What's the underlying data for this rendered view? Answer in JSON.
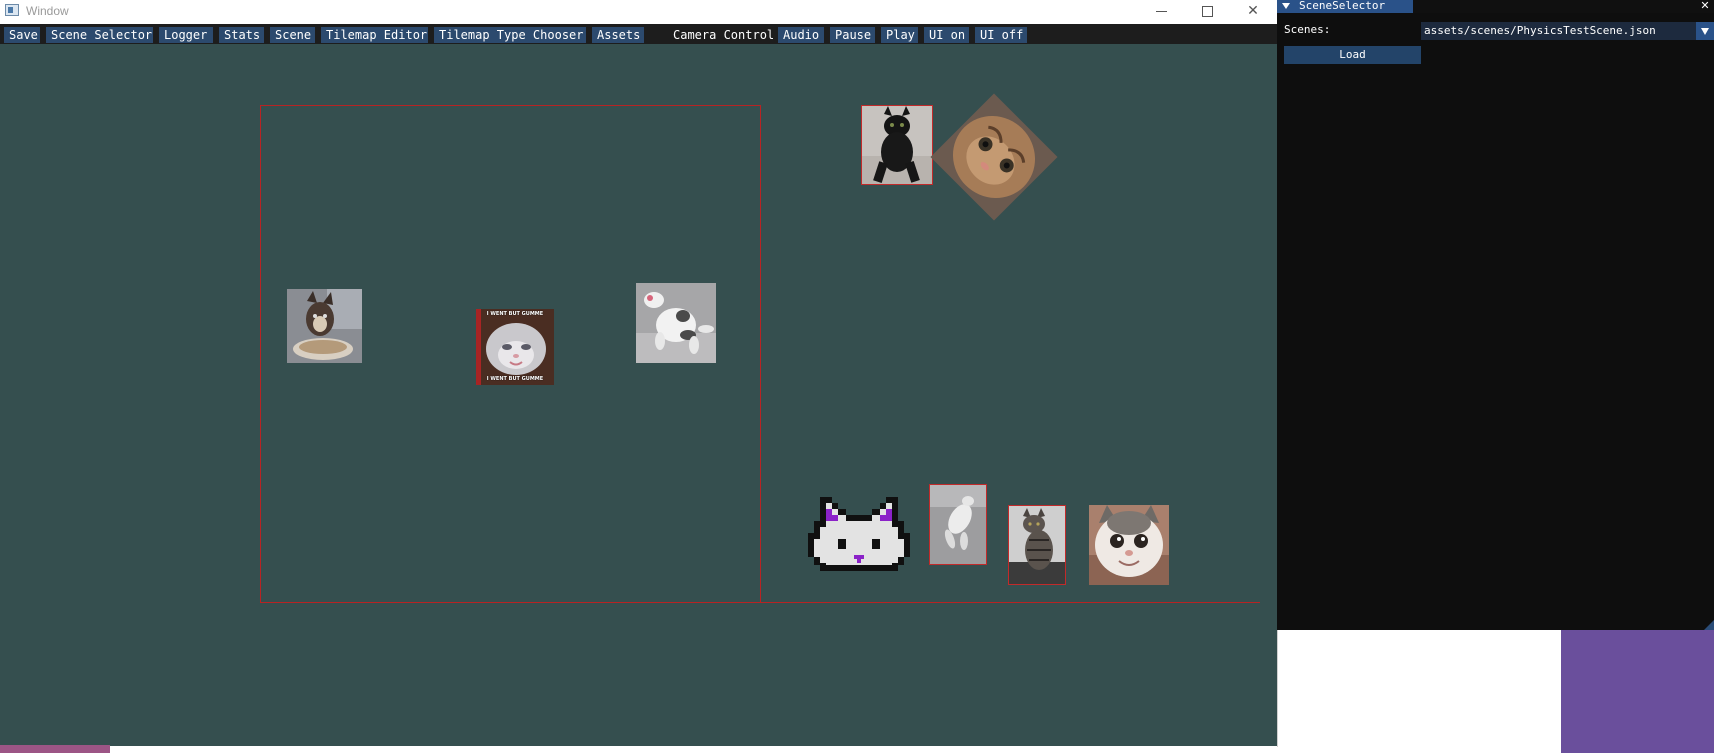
{
  "window": {
    "title": "Window",
    "minimize_icon": "minimize-icon",
    "maximize_icon": "maximize-icon",
    "close_glyph": "✕"
  },
  "menu": {
    "items": [
      "Save",
      "Scene Selector",
      "Logger",
      "Stats",
      "Scene",
      "Tilemap Editor",
      "Tilemap Type Chooser",
      "Assets",
      "Camera Control",
      "Audio",
      "Pause",
      "Play",
      "UI on",
      "UI off"
    ]
  },
  "colors": {
    "viewport_bg": "#354f4f",
    "collider_outline": "#b82323",
    "menu_button": "#2c4a6e",
    "imgui_bg": "#0e0e0e",
    "imgui_accent": "#2a5289"
  },
  "scene": {
    "sprites": [
      "cat-plate-photo",
      "crying-kitten-meme",
      "dancing-cat-photo",
      "black-cat-photo",
      "tilted-cat-closeup-photo",
      "pixel-cat-face",
      "jumping-cat-photo",
      "tabby-cat-photo",
      "smiling-cat-photo"
    ],
    "meme_caption_top": "I WENT BUT GUMME",
    "meme_caption_bottom": "I WENT BUT GUMME"
  },
  "scene_selector": {
    "title": "SceneSelector",
    "close_glyph": "✕",
    "scenes_label": "Scenes:",
    "scenes_value": "assets/scenes/PhysicsTestScene.json",
    "load_label": "Load"
  }
}
